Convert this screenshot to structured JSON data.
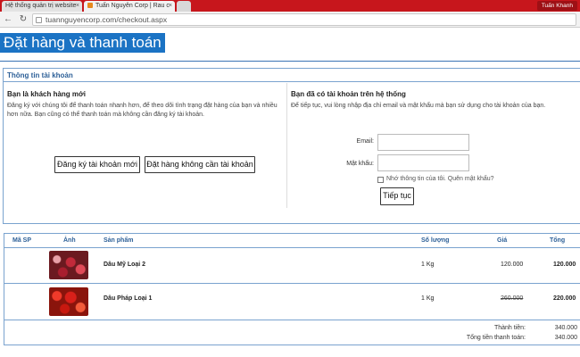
{
  "browser": {
    "tabs": [
      {
        "title": "Hệ thống quản trị website"
      },
      {
        "title": "Tuấn Nguyên Corp | Rau c"
      }
    ],
    "user": "Tuấn Khanh",
    "url": "tuannguyencorp.com/checkout.aspx"
  },
  "page": {
    "title": "Đặt hàng và thanh toán"
  },
  "account": {
    "header": "Thông tin tài khoản",
    "guest": {
      "title": "Bạn là khách hàng mới",
      "text_line1": "Đăng ký với chúng tôi để thanh toán nhanh hơn, để theo dõi tình trạng đặt hàng của bạn và nhiều",
      "text_line2": "hơn nữa. Bạn cũng có thể thanh toán mà không cần đăng ký tài khoản.",
      "register_button": "Đăng ký tài khoản mới",
      "guest_checkout_button": "Đặt hàng không cần tài khoản"
    },
    "member": {
      "title": "Bạn đã có tài khoản trên hệ thống",
      "text": "Để tiếp tục, vui lòng nhập địa chỉ email và mật khẩu mà bạn sử dụng cho tài khoản của bạn.",
      "email_label": "Email:",
      "password_label": "Mật khẩu:",
      "remember_text": "Nhớ thông tin của tôi. Quên mật khẩu?",
      "continue_button": "Tiếp tục"
    }
  },
  "cart": {
    "headers": {
      "sku": "Mã SP",
      "image": "Ảnh",
      "product": "Sản phẩm",
      "qty": "Số lượng",
      "price": "Giá",
      "total": "Tổng"
    },
    "items": [
      {
        "name": "Dâu Mỹ Loại 2",
        "qty": "1 Kg",
        "price": "120.000",
        "old_price": "",
        "total": "120.000"
      },
      {
        "name": "Dâu Pháp Loại 1",
        "qty": "1 Kg",
        "price": "",
        "old_price": "260.000",
        "total": "220.000"
      }
    ],
    "subtotal_label": "Thành tiền:",
    "subtotal_value": "340.000",
    "grand_total_label": "Tổng tiền thanh toán:",
    "grand_total_value": "340.000"
  },
  "colors": {
    "brand_red": "#c7161c",
    "title_blue": "#1b73c4",
    "header_blue": "#2c5f97"
  }
}
